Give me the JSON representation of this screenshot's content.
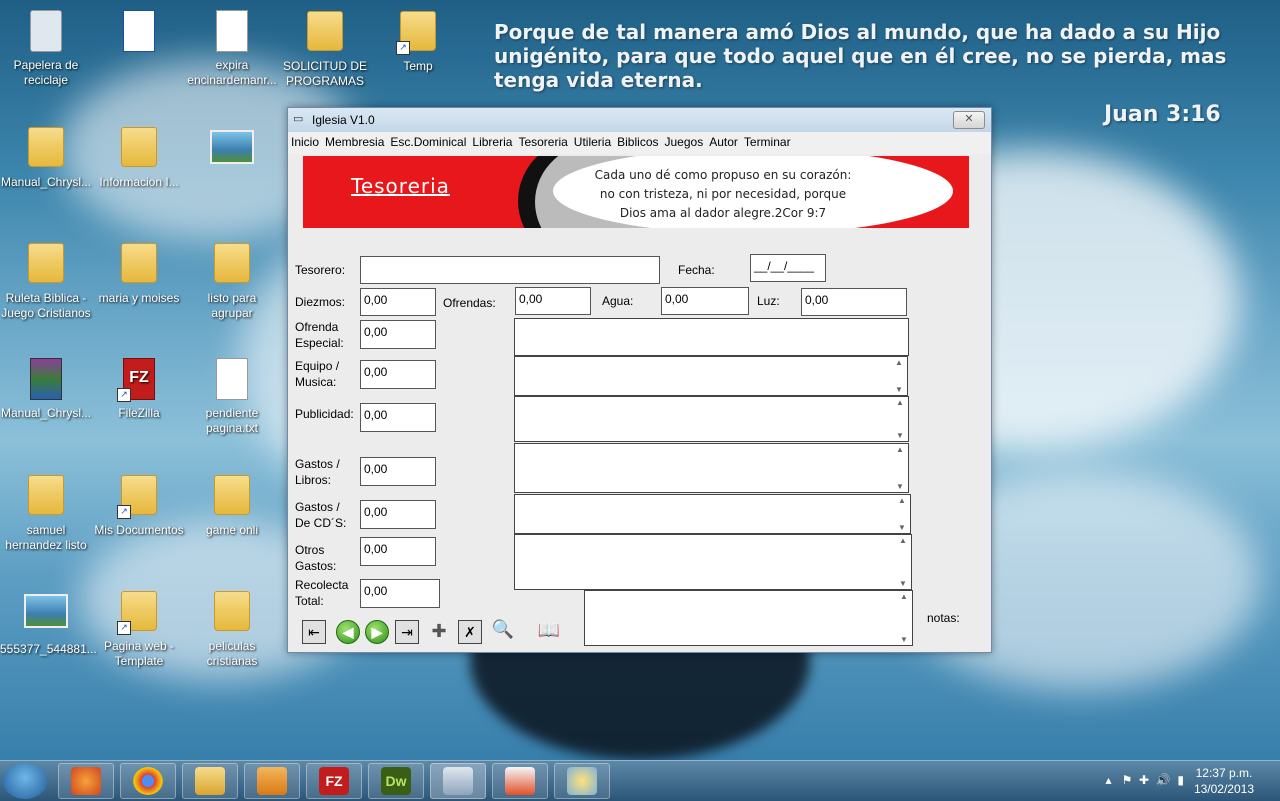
{
  "desktop": {
    "verse_text": "Porque de tal manera amó Dios al mundo, que ha dado a su Hijo unigénito, para que todo aquel que en él cree, no se pierda, mas tenga vida eterna.",
    "verse_ref": "Juan 3:16",
    "icons": [
      {
        "label": "Papelera de reciclaje"
      },
      {
        "label": ""
      },
      {
        "label": "expira encinardemanr..."
      },
      {
        "label": "SOLICITUD DE PROGRAMAS"
      },
      {
        "label": "Temp"
      },
      {
        "label": "Manual_Chrysl..."
      },
      {
        "label": "Informacion I..."
      },
      {
        "label": ""
      },
      {
        "label": "Ruleta Biblica - Juego Cristianos"
      },
      {
        "label": "maria y moises"
      },
      {
        "label": "listo para agrupar"
      },
      {
        "label": "Manual_Chrysl..."
      },
      {
        "label": "FileZilla"
      },
      {
        "label": "pendiente pagina.txt"
      },
      {
        "label": "samuel hernandez listo"
      },
      {
        "label": "Mis Documentos"
      },
      {
        "label": "game onli"
      },
      {
        "label": "555377_544881..."
      },
      {
        "label": "Pagina web - Template"
      },
      {
        "label": "peliculas cristianas"
      }
    ]
  },
  "window": {
    "title": "Iglesia V1.0",
    "close": "✕",
    "menu": [
      "Inicio",
      "Membresia",
      "Esc.Dominical",
      "Libreria",
      "Tesoreria",
      "Utileria",
      "Biblicos",
      "Juegos",
      "Autor",
      "Terminar"
    ],
    "banner": {
      "title": "Tesoreria",
      "quote_line1": "Cada uno dé como propuso en su corazón:",
      "quote_line2": "no con tristeza,  ni por necesidad,  porque",
      "quote_line3": "Dios ama al dador alegre.2Cor 9:7"
    },
    "form": {
      "tesorero_label": "Tesorero:",
      "tesorero_value": "",
      "fecha_label": "Fecha:",
      "fecha_value": "__/__/____",
      "diezmos_label": "Diezmos:",
      "diezmos_value": "0,00",
      "ofrendas_label": "Ofrendas:",
      "ofrendas_value": "0,00",
      "agua_label": "Agua:",
      "agua_value": "0,00",
      "luz_label": "Luz:",
      "luz_value": "0,00",
      "ofrenda_especial_label1": "Ofrenda",
      "ofrenda_especial_label2": "Especial:",
      "ofrenda_especial_value": "0,00",
      "equipo_label1": "Equipo /",
      "equipo_label2": "Musica:",
      "equipo_value": "0,00",
      "publicidad_label": "Publicidad:",
      "publicidad_value": "0,00",
      "gastos_libros_label1": "Gastos /",
      "gastos_libros_label2": "Libros:",
      "gastos_libros_value": "0,00",
      "gastos_cds_label1": "Gastos /",
      "gastos_cds_label2": "De CD´S:",
      "gastos_cds_value": "0,00",
      "otros_label1": "Otros",
      "otros_label2": "Gastos:",
      "otros_value": "0,00",
      "recolecta_label1": "Recolecta",
      "recolecta_label2": "Total:",
      "recolecta_value": "0,00",
      "notas_label": "notas:"
    },
    "toolbar": {
      "first": "⇤",
      "prev": "◀",
      "next": "▶",
      "last": "⇥",
      "add": "✚",
      "delete": "✗",
      "search": "🔍",
      "book": "📖"
    }
  },
  "taskbar": {
    "time": "12:37 p.m.",
    "date": "13/02/2013",
    "tasks": [
      "firefox-icon",
      "chrome-icon",
      "explorer-icon",
      "media-icon",
      "filezilla-icon",
      "dreamweaver-icon",
      "app-icon",
      "powerpoint-icon",
      "paint-icon"
    ],
    "dw_text": "Dw",
    "fz_text": "FZ"
  }
}
